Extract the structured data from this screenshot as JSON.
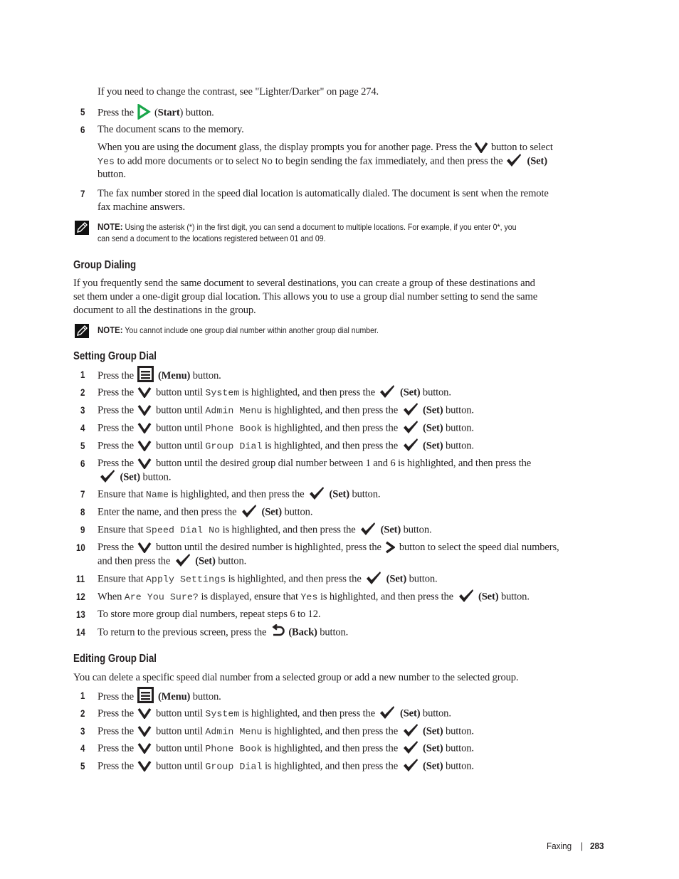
{
  "intro": {
    "contrast_text": "If you need to change the contrast, see \"Lighter/Darker\" on page 274."
  },
  "sending_steps": [
    {
      "num": "5",
      "pre": "Press the",
      "icon": "start-icon",
      "button": "Start",
      "post": "button."
    },
    {
      "num": "6",
      "text": "The document scans to the memory."
    },
    {
      "num": "7",
      "line1": "The fax number stored in the speed dial location is automatically dialed. The document is sent when the remote",
      "line2": "fax machine answers."
    }
  ],
  "glass_prompt": {
    "line1_pre": "When you are using the document glass, the display prompts you for another page. Press the",
    "line1_post": "button to select",
    "yes": "Yes",
    "line2_mid": "to add more documents or to select",
    "no": "No",
    "line2_post": "to begin sending the fax immediately, and then press the",
    "set": "(Set)",
    "line3": "button."
  },
  "note1": {
    "label": "NOTE:",
    "line1": "Using the asterisk (*) in the first digit, you can send a document to multiple locations. For example, if you enter 0*, you",
    "line2": "can send a document to the locations registered between 01 and 09."
  },
  "group_dialing": {
    "heading": "Group Dialing",
    "para": [
      "If you frequently send the same document to several destinations, you can create a group of these destinations and",
      "set them under a one-digit group dial location. This allows you to use a group dial number setting to send the same",
      "document to all the destinations in the group."
    ]
  },
  "note2": {
    "label": "NOTE:",
    "text": "You cannot include one group dial number within another group dial number."
  },
  "setting_group_dial": {
    "heading": "Setting Group Dial",
    "steps": [
      {
        "num": "1",
        "pre": "Press the",
        "button": "(Menu)",
        "post": "button."
      },
      {
        "num": "2",
        "pre": "Press the",
        "mid": "button until",
        "code": "System",
        "post": "is highlighted, and then press the",
        "set": "(Set)",
        "end": "button."
      },
      {
        "num": "3",
        "pre": "Press the",
        "mid": "button until",
        "code": "Admin Menu",
        "post": "is highlighted, and then press the",
        "set": "(Set)",
        "end": "button."
      },
      {
        "num": "4",
        "pre": "Press the",
        "mid": "button until",
        "code": "Phone Book",
        "post": "is highlighted, and then press the",
        "set": "(Set)",
        "end": "button."
      },
      {
        "num": "5",
        "pre": "Press the",
        "mid": "button until",
        "code": "Group Dial",
        "post": "is highlighted, and then press the",
        "set": "(Set)",
        "end": "button."
      },
      {
        "num": "6",
        "pre": "Press the",
        "mid": "button until the desired group dial number between 1 and 6 is highlighted, and then press the",
        "set": "(Set)",
        "end": "button."
      },
      {
        "num": "7",
        "pre": "Ensure that",
        "code": "Name",
        "post": "is highlighted, and then press the",
        "set": "(Set)",
        "end": "button."
      },
      {
        "num": "8",
        "pre": "Enter the name, and then press the",
        "set": "(Set)",
        "end": "button."
      },
      {
        "num": "9",
        "pre": "Ensure that",
        "code": "Speed Dial No",
        "post": "is highlighted, and then press the",
        "set": "(Set)",
        "end": "button."
      },
      {
        "num": "10",
        "pre": "Press the",
        "mid": "button until the desired number is highlighted, press the",
        "post": "button to select the speed dial numbers,",
        "line2": "and then press the",
        "set": "(Set)",
        "end": "button."
      },
      {
        "num": "11",
        "pre": "Ensure that",
        "code": "Apply Settings",
        "post": "is highlighted, and then press the",
        "set": "(Set)",
        "end": "button."
      },
      {
        "num": "12",
        "pre": "When",
        "code": "Are You Sure?",
        "mid": "is displayed, ensure that",
        "code2": "Yes",
        "post": "is highlighted, and then press the",
        "set": "(Set)",
        "end": "button."
      },
      {
        "num": "13",
        "text": "To store more group dial numbers, repeat steps 6 to 12."
      },
      {
        "num": "14",
        "pre": "To return to the previous screen, press the",
        "button": "(Back)",
        "post": "button."
      }
    ]
  },
  "editing_group_dial": {
    "heading": "Editing Group Dial",
    "para": "You can delete a specific speed dial number from a selected group or add a new number to the selected group.",
    "steps": [
      {
        "num": "1",
        "pre": "Press the",
        "button": "(Menu)",
        "post": "button."
      },
      {
        "num": "2",
        "pre": "Press the",
        "mid": "button until",
        "code": "System",
        "post": "is highlighted, and then press the",
        "set": "(Set)",
        "end": "button."
      },
      {
        "num": "3",
        "pre": "Press the",
        "mid": "button until",
        "code": "Admin Menu",
        "post": "is highlighted, and then press the",
        "set": "(Set)",
        "end": "button."
      },
      {
        "num": "4",
        "pre": "Press the",
        "mid": "button until",
        "code": "Phone Book",
        "post": "is highlighted, and then press the",
        "set": "(Set)",
        "end": "button."
      },
      {
        "num": "5",
        "pre": "Press the",
        "mid": "button until",
        "code": "Group Dial",
        "post": "is highlighted, and then press the",
        "set": "(Set)",
        "end": "button."
      }
    ]
  },
  "footer": {
    "section": "Faxing",
    "separator": "|",
    "page": "283"
  },
  "colors": {
    "start_icon": "#1aa64a",
    "text": "#231f20"
  }
}
